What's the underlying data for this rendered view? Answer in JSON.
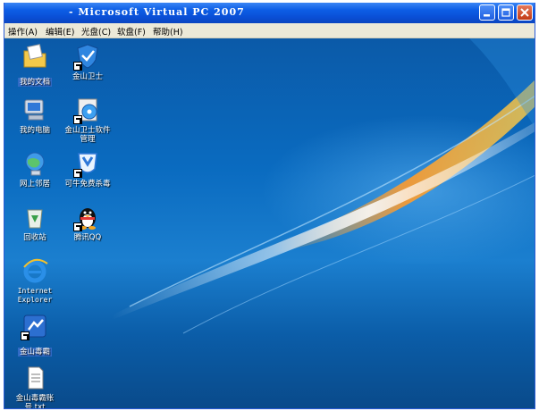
{
  "window": {
    "title": "- Microsoft Virtual PC 2007"
  },
  "menu": [
    {
      "label": "操作(A)"
    },
    {
      "label": "编辑(E)"
    },
    {
      "label": "光盘(C)"
    },
    {
      "label": "软盘(F)"
    },
    {
      "label": "帮助(H)"
    }
  ],
  "desktop": {
    "icons": [
      {
        "label": "我的文档",
        "icon": "my-documents-icon"
      },
      {
        "label": "金山卫士",
        "icon": "kingsoft-guard-icon"
      },
      {
        "label": "我的电脑",
        "icon": "my-computer-icon"
      },
      {
        "label": "金山卫士软件\n管理",
        "icon": "software-manager-icon"
      },
      {
        "label": "网上邻居",
        "icon": "network-places-icon"
      },
      {
        "label": "可牛免费杀毒",
        "icon": "keniu-antivirus-icon"
      },
      {
        "label": "回收站",
        "icon": "recycle-bin-icon"
      },
      {
        "label": "腾讯QQ",
        "icon": "qq-penguin-icon"
      },
      {
        "label": "Internet\nExplorer",
        "icon": "ie-icon"
      },
      {
        "label": "金山毒霸",
        "icon": "kingsoft-antivirus-icon"
      },
      {
        "label": "金山毒霸账\n号.txt",
        "icon": "text-file-icon"
      }
    ]
  }
}
